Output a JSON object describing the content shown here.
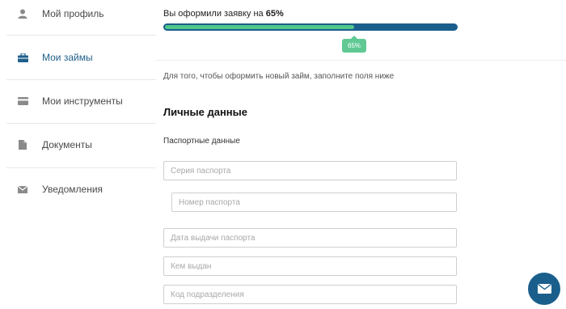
{
  "sidebar": {
    "items": [
      {
        "label": "Мой профиль",
        "icon": "user-icon",
        "active": false
      },
      {
        "label": "Мои займы",
        "icon": "briefcase-icon",
        "active": true
      },
      {
        "label": "Мои инструменты",
        "icon": "card-icon",
        "active": false
      },
      {
        "label": "Документы",
        "icon": "document-icon",
        "active": false
      },
      {
        "label": "Уведомления",
        "icon": "envelope-icon",
        "active": false
      }
    ]
  },
  "progress": {
    "prefix": "Вы оформили заявку на ",
    "value_text": "65%",
    "value": 65,
    "badge": "65%"
  },
  "main": {
    "hint": "Для того, чтобы оформить новый займ, заполните поля ниже",
    "section_title": "Личные данные",
    "subsection_title": "Паспортные данные"
  },
  "fields": {
    "series": {
      "placeholder": "Серия паспорта",
      "value": ""
    },
    "number": {
      "placeholder": "Номер паспорта",
      "value": ""
    },
    "issue_date": {
      "placeholder": "Дата выдачи паспорта",
      "value": ""
    },
    "issued_by": {
      "placeholder": "Кем выдан",
      "value": ""
    },
    "division_code": {
      "placeholder": "Код подразделения",
      "value": ""
    }
  },
  "colors": {
    "brand": "#1a5f8c",
    "progress_fill": "#4fc88b",
    "badge": "#60c993",
    "active_text": "#1f5f8b"
  },
  "chat": {
    "icon": "envelope-icon"
  }
}
